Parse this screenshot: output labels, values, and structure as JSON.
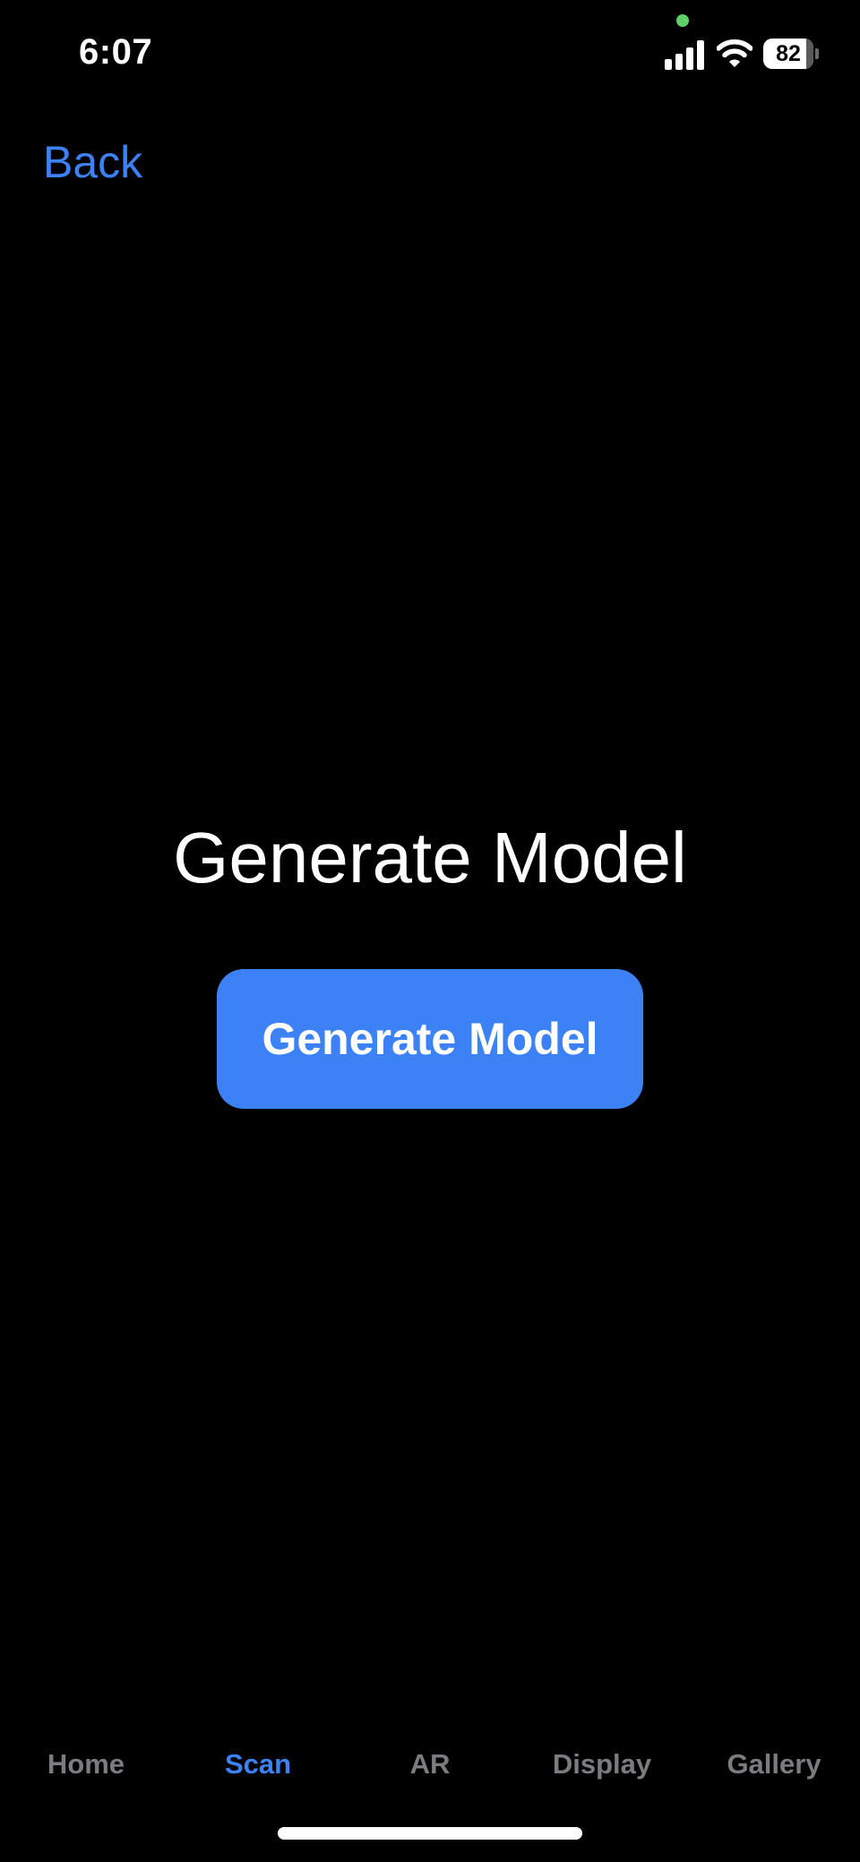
{
  "status_bar": {
    "time": "6:07",
    "battery_percent": "82",
    "icons": [
      "signal-icon",
      "wifi-icon",
      "battery-icon"
    ],
    "privacy_indicator_color": "#5fd068"
  },
  "nav": {
    "back_label": "Back"
  },
  "main": {
    "title": "Generate Model",
    "button_label": "Generate Model"
  },
  "tab_bar": {
    "tabs": [
      {
        "label": "Home",
        "active": false
      },
      {
        "label": "Scan",
        "active": true
      },
      {
        "label": "AR",
        "active": false
      },
      {
        "label": "Display",
        "active": false
      },
      {
        "label": "Gallery",
        "active": false
      }
    ]
  },
  "colors": {
    "background": "#000000",
    "accent": "#3c82f6",
    "inactive_tab": "#7c7c80",
    "text": "#ffffff"
  }
}
